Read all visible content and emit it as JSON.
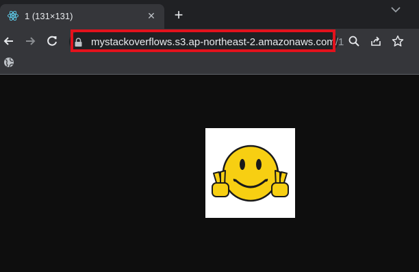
{
  "tab": {
    "title": "1 (131×131)",
    "favicon": "react-icon",
    "close_glyph": "✕"
  },
  "new_tab_glyph": "+",
  "toolbar": {
    "back": "back-arrow-icon",
    "forward": "forward-arrow-icon",
    "reload": "reload-icon"
  },
  "address_bar": {
    "host": "mystackoverflows.s3.ap-northeast-2.amazonaws.com",
    "path": "/1",
    "highlight_color": "#e3121c"
  },
  "content": {
    "image_dimensions": "131×131",
    "image": "smiley-peace-sign-icon"
  }
}
